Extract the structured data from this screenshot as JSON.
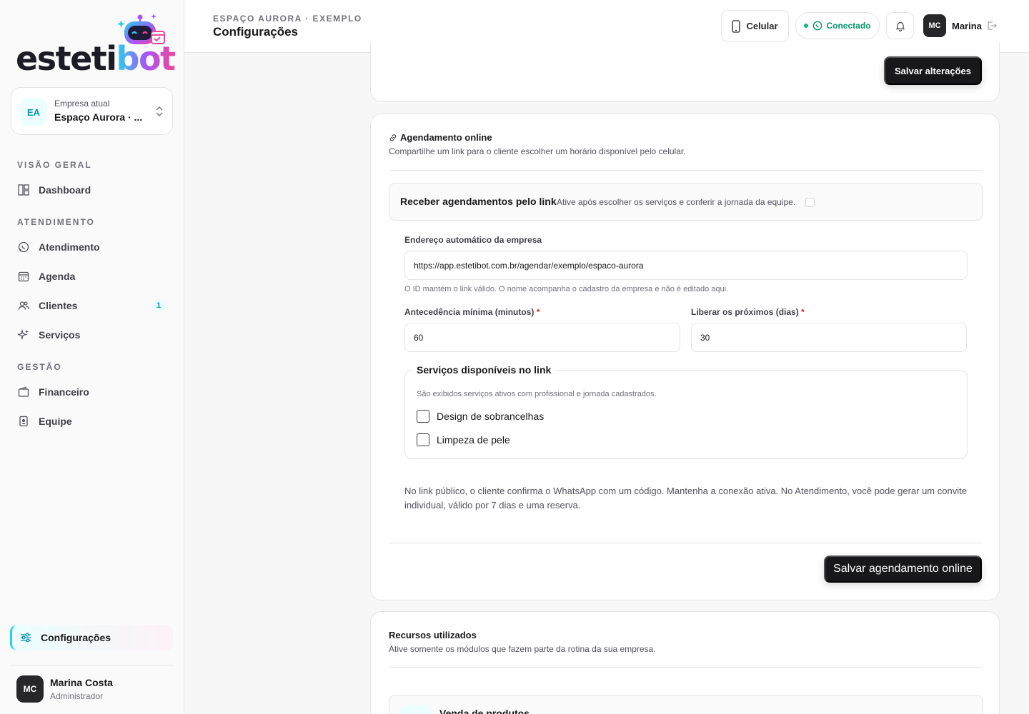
{
  "brand": {
    "name_prefix": "esteti",
    "name_suffix": "bot"
  },
  "company": {
    "initials": "EA",
    "label": "Empresa atual",
    "name": "Espaço Aurora · ..."
  },
  "nav": {
    "sections": [
      {
        "label": "VISÃO GERAL"
      },
      {
        "label": "ATENDIMENTO"
      },
      {
        "label": "GESTÃO"
      }
    ],
    "items": [
      {
        "label": "Dashboard",
        "icon": "dashboard-icon"
      },
      {
        "label": "Atendimento",
        "icon": "whatsapp-icon"
      },
      {
        "label": "Agenda",
        "icon": "calendar-icon"
      },
      {
        "label": "Clientes",
        "icon": "users-icon",
        "count": "1"
      },
      {
        "label": "Serviços",
        "icon": "sparkles-icon"
      },
      {
        "label": "Financeiro",
        "icon": "wallet-icon"
      },
      {
        "label": "Equipe",
        "icon": "badge-icon"
      }
    ],
    "settings": {
      "label": "Configurações",
      "icon": "sliders-icon"
    }
  },
  "user": {
    "initials": "MC",
    "name": "Marina Costa",
    "role": "Administrador"
  },
  "topbar": {
    "breadcrumb": "ESPAÇO AURORA · EXEMPLO",
    "title": "Configurações",
    "phone_label": "Celular",
    "whatsapp_status": "Conectado",
    "user_initials": "MC",
    "user_name": "Marina"
  },
  "card_top": {
    "save_label": "Salvar alterações"
  },
  "online": {
    "title": "Agendamento online",
    "subtitle": "Compartilhe um link para o cliente escolher um horário disponível pelo celular.",
    "toggle_title": "Receber agendamentos pelo link",
    "toggle_sub": "Ative após escolher os serviços e conferir a jornada da equipe.",
    "address_label": "Endereço automático da empresa",
    "address_value": "https://app.estetibot.com.br/agendar/exemplo/espaco-aurora",
    "address_help": "O ID mantém o link válido. O nome acompanha o cadastro da empresa e não é editado aqui.",
    "min_label": "Antecedência mínima (minutos)",
    "min_value": "60",
    "days_label": "Liberar os próximos (dias)",
    "days_value": "30",
    "required_mark": "*",
    "services_legend": "Serviços disponíveis no link",
    "services_help": "São exibidos serviços ativos com profissional e jornada cadastrados.",
    "services": [
      {
        "label": "Design de sobrancelhas"
      },
      {
        "label": "Limpeza de pele"
      }
    ],
    "note": "No link público, o cliente confirma o WhatsApp com um código. Mantenha a conexão ativa. No Atendimento, você pode gerar um convite individual, válido por 7 dias e uma reserva.",
    "save_label": "Salvar agendamento online"
  },
  "resources": {
    "title": "Recursos utilizados",
    "subtitle": "Ative somente os módulos que fazem parte da rotina da sua empresa.",
    "modules": [
      {
        "label": "Venda de produtos"
      }
    ]
  }
}
